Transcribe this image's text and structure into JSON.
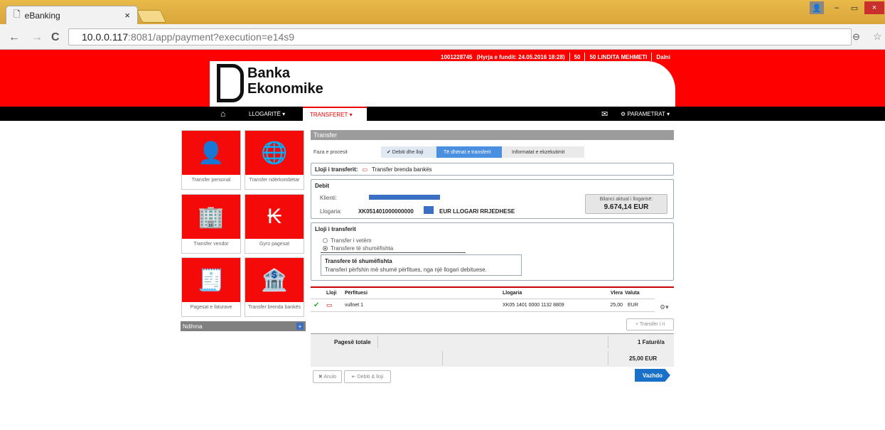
{
  "browser": {
    "tab_title": "eBanking",
    "tab_close": "×",
    "url_host": "10.0.0.117",
    "url_rest": ":8081/app/payment?execution=e14s9",
    "win_min": "–",
    "win_max": "▭",
    "win_close": "×",
    "back": "←",
    "forward": "→",
    "reload": "C"
  },
  "top": {
    "account": "1001228745",
    "last_login": "(Hyrja e fundit: 24.05.2016 18:28)",
    "code": "50",
    "user": "50 LINDITA MEHMETI",
    "logout": "Dalni"
  },
  "logo": {
    "line1": "Banka",
    "line2": "Ekonomike"
  },
  "nav": {
    "accounts": "LLOGARITË",
    "transfers": "TRANSFERET",
    "params": "PARAMETRAT"
  },
  "tiles": [
    {
      "label": "Transfer personal"
    },
    {
      "label": "Transfer ndërkombëtar"
    },
    {
      "label": "Transfer vendor"
    },
    {
      "label": "Gyro pagesat"
    },
    {
      "label": "Pagesat e faturave"
    },
    {
      "label": "Transfer brenda bankës"
    }
  ],
  "help": {
    "label": "Ndihma",
    "plus": "+"
  },
  "panel": {
    "title": "Transfer",
    "process_label": "Faza e procesit",
    "step1": "✔ Debiti dhe lloji",
    "step2": "Të dhënat e transferit",
    "step3": "Informatat e ekzekutimit",
    "type_label": "Lloji i transferit:",
    "type_value": "Transfer brenda bankës",
    "debit_title": "Debit",
    "client_label": "Klienti:",
    "account_label": "Llogaria:",
    "account_value": "XK051401000000000",
    "account_desc": "EUR LLOGARI RRJEDHESE",
    "balance_label": "Bilanci aktual i llogarisë:",
    "balance_value": "9.674,14 EUR",
    "ttype_title": "Lloji i transferit",
    "opt_single": "Transfer i vetëm",
    "opt_multi": "Transfere të shumëfishta",
    "info_title": "Transfere të shumëfishta",
    "info_text": "Transferi përfshin më shumë përfitues, nga një llogari debituese."
  },
  "table": {
    "headers": [
      "Lloji",
      "Përfituesi",
      "Llogaria",
      "Vlera",
      "Valuta"
    ],
    "row": {
      "beneficiary": "vullnet 1",
      "account": "XK05 1401 0000 1132 8809",
      "amount": "25,00",
      "currency": "EUR"
    },
    "new_transfer": "+ Transfer i ri"
  },
  "totals": {
    "label": "Pagesë totale",
    "count": "1 Faturë/a",
    "amount": "25,00 EUR"
  },
  "buttons": {
    "cancel": "✖ Anulo",
    "back": "⇤ Debiti & lloji",
    "next": "Vazhdo"
  },
  "colors": {
    "brand_red": "#ff0000",
    "nav_black": "#000000",
    "next_blue": "#1a6fc9"
  }
}
